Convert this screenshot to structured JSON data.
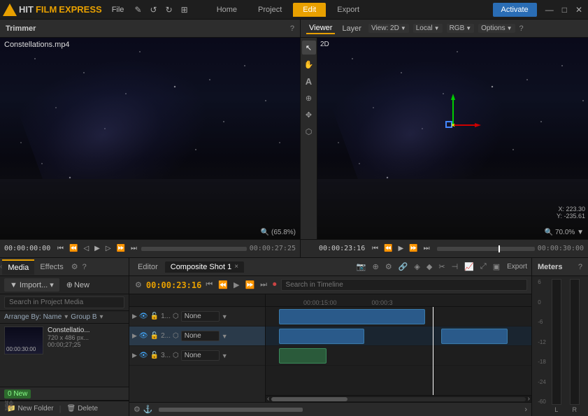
{
  "app": {
    "name": "HITFILM EXPRESS",
    "logo_hit": "HIT",
    "logo_film": "FILM",
    "logo_express": "EXPRESS"
  },
  "menu": {
    "file": "File",
    "edit_icon": "✎",
    "redo": "↺",
    "undo": "↻",
    "grid": "⊞",
    "home": "Home",
    "project": "Project",
    "edit": "Edit",
    "export": "Export",
    "activate": "Activate"
  },
  "trimmer": {
    "title": "Trimmer",
    "help": "?",
    "filename": "Constellations.mp4",
    "zoom": "(65.8%)",
    "time_start": "00:00:00:00",
    "time_end": "00:00:27:25",
    "magnifier": "🔍"
  },
  "viewer": {
    "title": "Viewer",
    "tabs": [
      "Viewer",
      "Layer"
    ],
    "view_label": "View: 2D",
    "local_label": "Local",
    "rgb_label": "RGB",
    "options_label": "Options",
    "help": "?",
    "badge_2d": "2D",
    "zoom": "70.0%",
    "x_coord": "X: 223.30",
    "y_coord": "Y: -235.61",
    "time": "00:00:23:16",
    "magnifier": "🔍",
    "tools": [
      "↖",
      "✋",
      "A",
      "⊕",
      "✥",
      "⬡"
    ]
  },
  "media_panel": {
    "tabs": [
      "Media",
      "Effects"
    ],
    "import_label": "Import...",
    "new_label": "New",
    "search_placeholder": "Search in Project Media",
    "arrange_label": "Arrange By: Name",
    "group_label": "Group B",
    "new_badge": "0 New",
    "media_items": [
      {
        "name": "Constellatio...",
        "meta1": "720 x 486 px...",
        "meta2": "00:00;27;25"
      }
    ],
    "new_folder": "New Folder",
    "delete": "Delete"
  },
  "editor": {
    "tab_editor": "Editor",
    "tab_composite": "Composite Shot 1",
    "close_icon": "×",
    "time": "00:00:23:16",
    "search_placeholder": "Search in Timeline",
    "export_label": "Export",
    "tracks": [
      {
        "num": "1...",
        "name": "None",
        "visible": true
      },
      {
        "num": "2...",
        "name": "None",
        "visible": true,
        "selected": true
      },
      {
        "num": "3...",
        "name": "None",
        "visible": true
      }
    ],
    "ruler_marks": [
      "",
      "00:00:15:00",
      "00:00:3"
    ],
    "playhead_pos": "63%"
  },
  "meters": {
    "title": "Meters",
    "help": "?",
    "channels": [
      "L",
      "R"
    ],
    "scale": [
      "6",
      "0",
      "-6",
      "-12",
      "-18",
      "-24",
      "-60"
    ]
  }
}
